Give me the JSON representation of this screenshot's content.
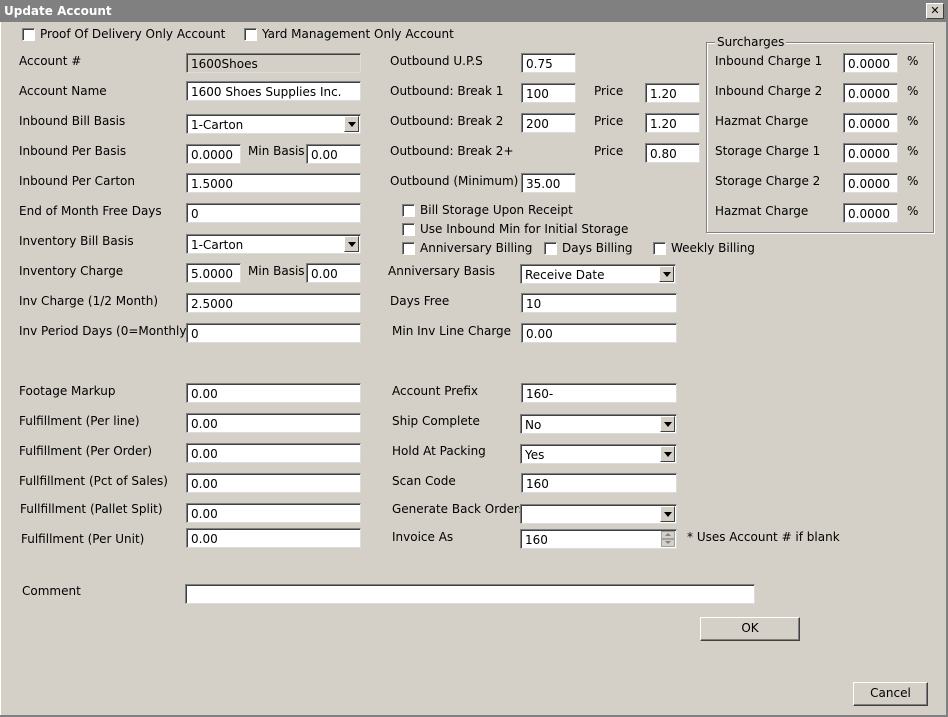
{
  "window": {
    "title": "Update Account",
    "close_label": "✕"
  },
  "options": {
    "proof_of_delivery": "Proof Of Delivery Only Account",
    "yard_management": "Yard Management Only Account"
  },
  "left": {
    "account_no": {
      "label": "Account #",
      "value": "1600Shoes"
    },
    "account_name": {
      "label": "Account Name",
      "value": "1600 Shoes Supplies Inc."
    },
    "inbound_bill_basis": {
      "label": "Inbound Bill Basis",
      "value": "1-Carton"
    },
    "inbound_per_basis": {
      "label": "Inbound Per Basis",
      "value": "0.0000",
      "min_label": "Min Basis",
      "min_value": "0.00"
    },
    "inbound_per_carton": {
      "label": "Inbound Per Carton",
      "value": "1.5000"
    },
    "eom_free_days": {
      "label": "End of Month Free Days",
      "value": "0"
    },
    "inventory_bill_basis": {
      "label": "Inventory Bill Basis",
      "value": "1-Carton"
    },
    "inventory_charge": {
      "label": "Inventory Charge",
      "value": "5.0000",
      "min_label": "Min Basis",
      "min_value": "0.00"
    },
    "inv_charge_half": {
      "label": "Inv Charge (1/2 Month)",
      "value": "2.5000"
    },
    "inv_period_days": {
      "label": "Inv Period Days (0=Monthly)",
      "value": "0"
    },
    "footage_markup": {
      "label": "Footage Markup",
      "value": "0.00"
    },
    "fulfillment_line": {
      "label": "Fulfillment (Per line)",
      "value": "0.00"
    },
    "fulfillment_order": {
      "label": "Fulfillment (Per Order)",
      "value": "0.00"
    },
    "fulfillment_pct": {
      "label": "Fullfillment (Pct of Sales)",
      "value": "0.00"
    },
    "fulfillment_pallet": {
      "label": "Fullfillment (Pallet Split)",
      "value": "0.00"
    },
    "fulfillment_unit": {
      "label": "Fulfillment (Per Unit)",
      "value": "0.00"
    }
  },
  "middle": {
    "outbound_ups": {
      "label": "Outbound U.P.S",
      "value": "0.75"
    },
    "break1": {
      "label": "Outbound: Break 1",
      "value": "100",
      "price_label": "Price",
      "price": "1.20"
    },
    "break2": {
      "label": "Outbound: Break 2",
      "value": "200",
      "price_label": "Price",
      "price": "1.20"
    },
    "break2plus": {
      "label": "Outbound: Break 2+",
      "price_label": "Price",
      "price": "0.80"
    },
    "outbound_min": {
      "label": "Outbound (Minimum)",
      "value": "35.00"
    },
    "bill_storage_receipt": "Bill Storage Upon Receipt",
    "use_inbound_min": "Use Inbound Min for Initial Storage",
    "anniversary_billing": "Anniversary Billing",
    "days_billing": "Days Billing",
    "weekly_billing": "Weekly Billing",
    "anniversary_basis": {
      "label": "Anniversary Basis",
      "value": "Receive Date"
    },
    "days_free": {
      "label": "Days Free",
      "value": "10"
    },
    "min_inv_line": {
      "label": "Min Inv Line Charge",
      "value": "0.00"
    },
    "account_prefix": {
      "label": "Account Prefix",
      "value": "160-"
    },
    "ship_complete": {
      "label": "Ship Complete",
      "value": "No"
    },
    "hold_at_packing": {
      "label": "Hold At Packing",
      "value": "Yes"
    },
    "scan_code": {
      "label": "Scan Code",
      "value": "160"
    },
    "generate_back_orders": {
      "label": "Generate Back Orders",
      "value": ""
    },
    "invoice_as": {
      "label": "Invoice As",
      "value": "160",
      "note": "* Uses Account # if blank"
    }
  },
  "surcharges": {
    "title": "Surcharges",
    "percent": "%",
    "items": [
      {
        "label": "Inbound Charge 1",
        "value": "0.0000"
      },
      {
        "label": "Inbound Charge 2",
        "value": "0.0000"
      },
      {
        "label": "Hazmat Charge",
        "value": "0.0000"
      },
      {
        "label": "Storage Charge 1",
        "value": "0.0000"
      },
      {
        "label": "Storage Charge 2",
        "value": "0.0000"
      },
      {
        "label": "Hazmat Charge",
        "value": "0.0000"
      }
    ]
  },
  "comment": {
    "label": "Comment",
    "value": ""
  },
  "buttons": {
    "ok": "OK",
    "cancel": "Cancel"
  }
}
